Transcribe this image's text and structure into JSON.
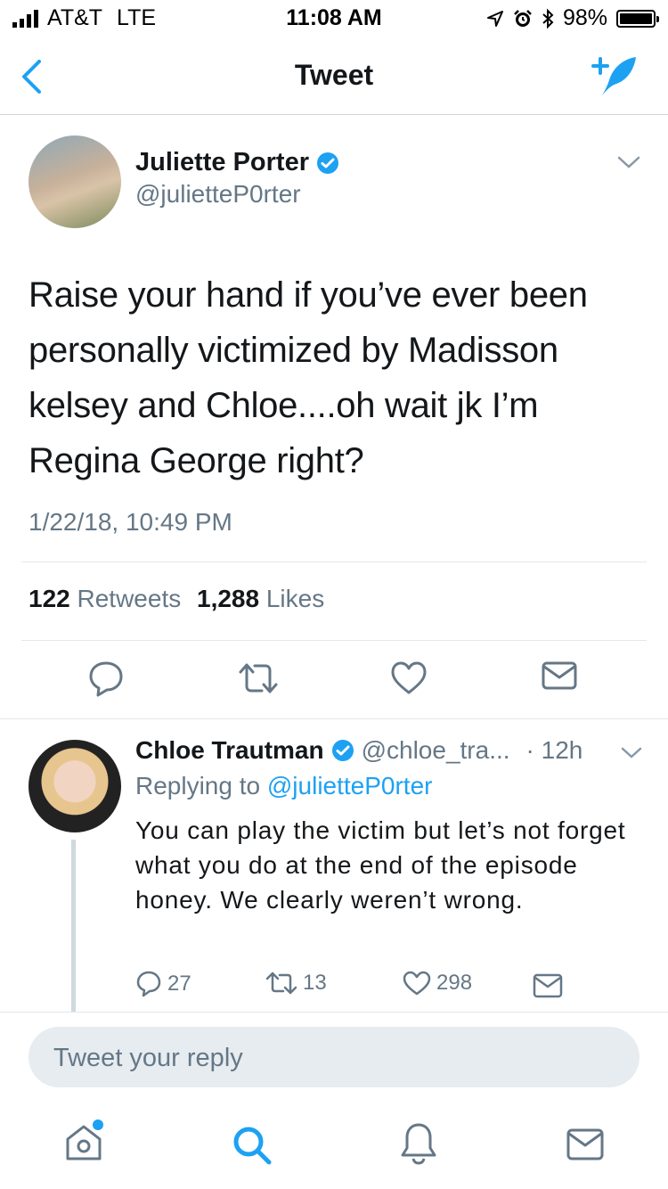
{
  "status_bar": {
    "carrier": "AT&T",
    "network": "LTE",
    "time": "11:08 AM",
    "battery": "98%",
    "icons": [
      "signal-bars-icon",
      "location-arrow-icon",
      "alarm-icon",
      "bluetooth-icon",
      "battery-icon"
    ]
  },
  "nav": {
    "title": "Tweet",
    "back_icon": "chevron-left-icon",
    "compose_icon": "compose-tweet-icon"
  },
  "tweet": {
    "author_name": "Juliette Porter",
    "handle": "@julietteP0rter",
    "verified": true,
    "text": "Raise your hand if you’ve ever been personally victimized by Madisson kelsey and Chloe....oh wait jk I’m Regina George right?",
    "timestamp": "1/22/18, 10:49 PM",
    "retweets_count": "122",
    "retweets_label": "Retweets",
    "likes_count": "1,288",
    "likes_label": "Likes"
  },
  "reply": {
    "author_name": "Chloe Trautman",
    "handle": "@chloe_tra...",
    "time": "· 12h",
    "replying_prefix": "Replying to",
    "replying_handle": "@julietteP0rter",
    "text": "You can play the victim but let’s not forget what you do at the end of the episode honey. We clearly weren’t wrong.",
    "reply_count": "27",
    "retweet_count": "13",
    "like_count": "298"
  },
  "compose": {
    "placeholder": "Tweet your reply"
  },
  "tabbar": {
    "items": [
      "home-icon",
      "search-icon",
      "notifications-icon",
      "messages-icon"
    ]
  },
  "colors": {
    "accent": "#1da1f2",
    "secondary_text": "#657786",
    "divider": "#e1e8ed"
  }
}
